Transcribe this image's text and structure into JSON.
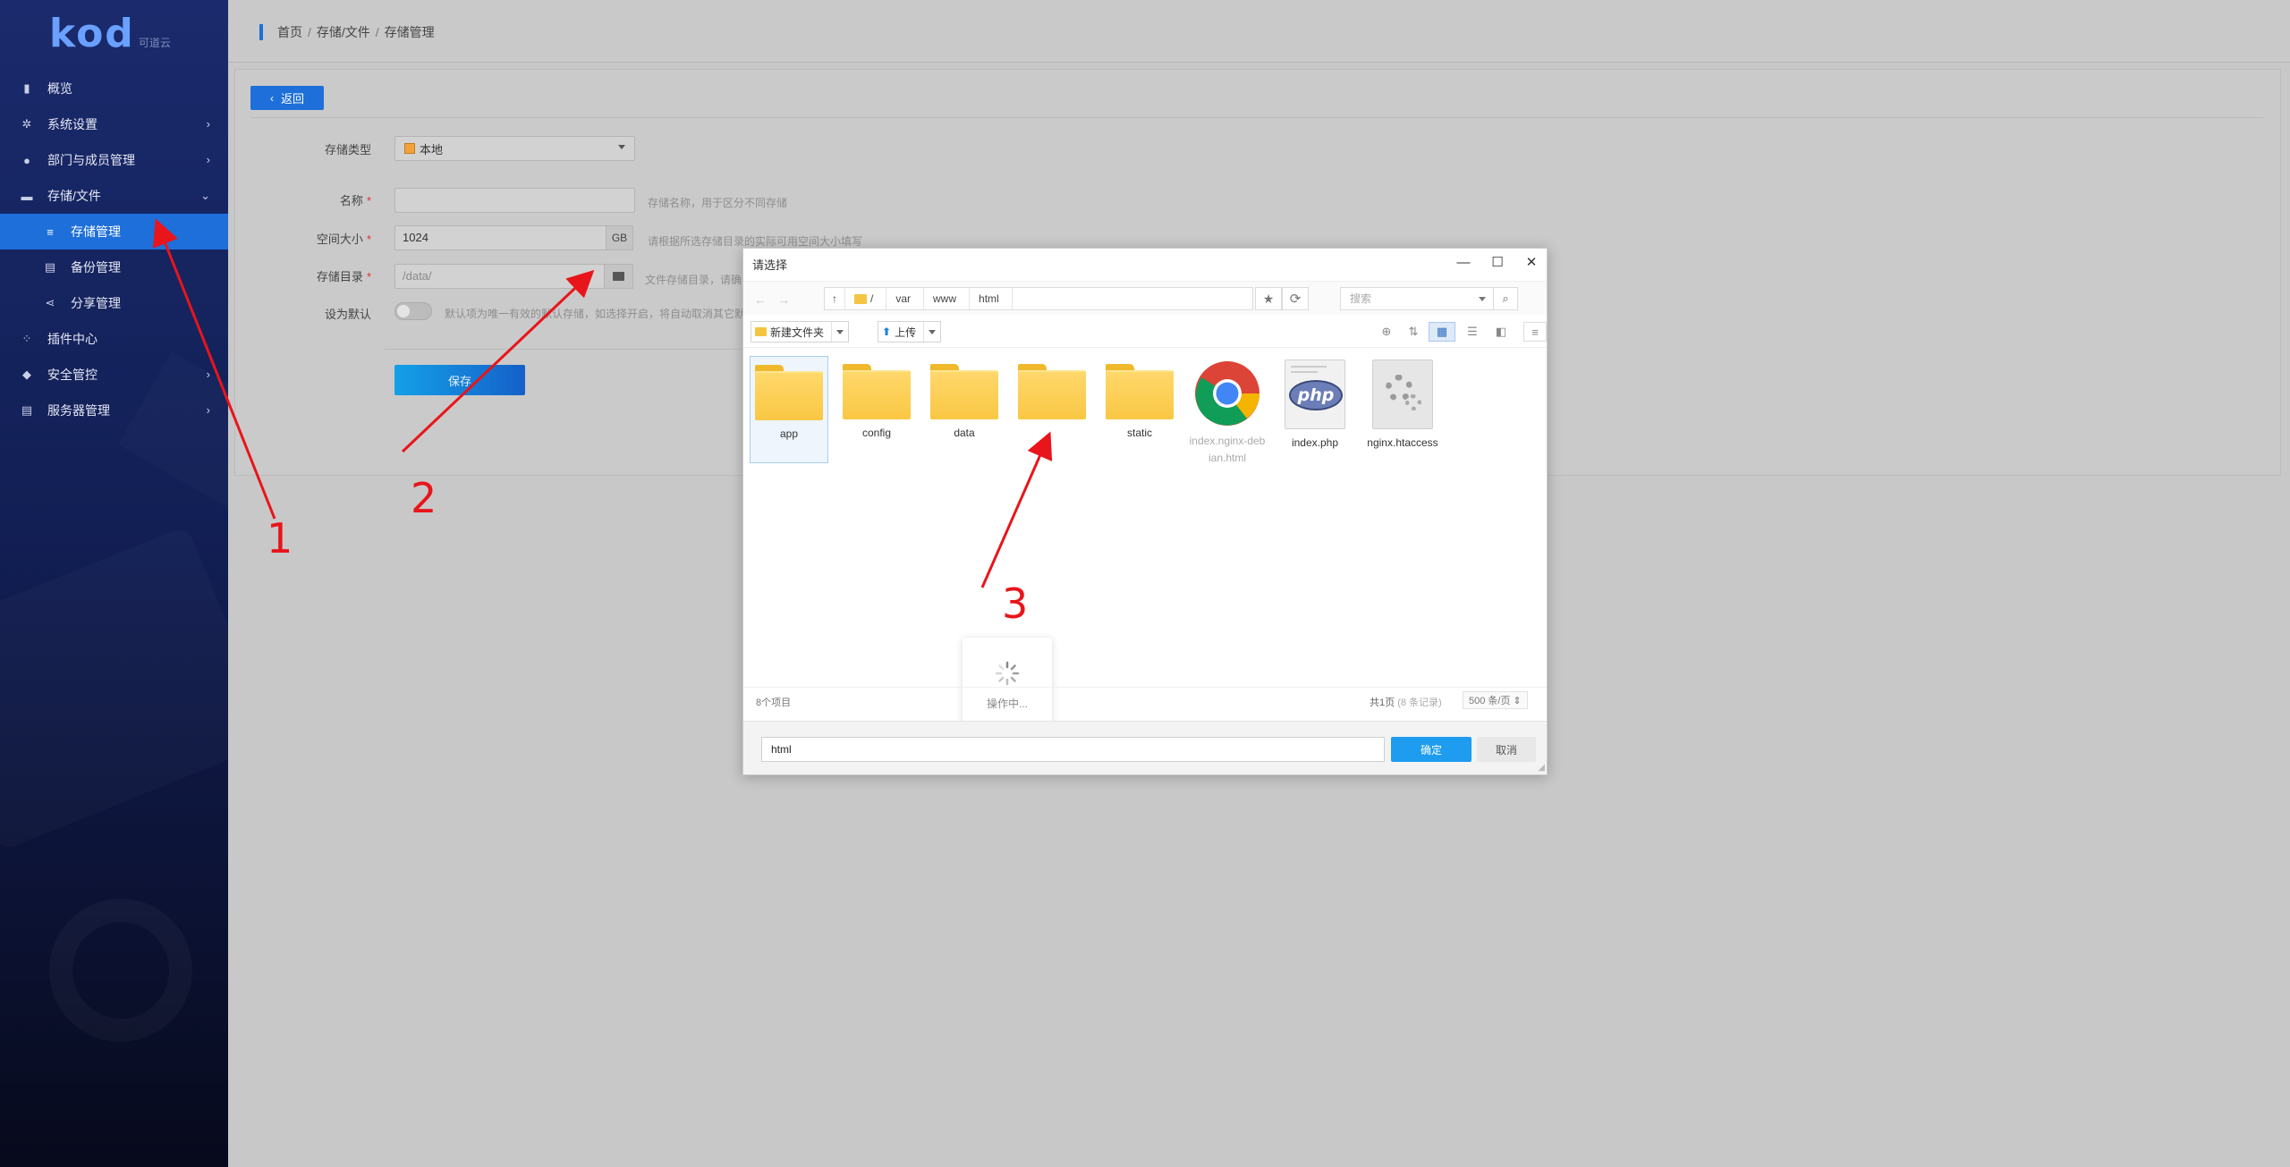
{
  "sidebar": {
    "logo_text": "kod",
    "logo_sub": "可道云",
    "items": [
      {
        "label": "概览",
        "icon": "bar-chart-icon",
        "glyph": "▮"
      },
      {
        "label": "系统设置",
        "icon": "gear-icon",
        "glyph": "✲"
      },
      {
        "label": "部门与成员管理",
        "icon": "user-icon",
        "glyph": "●"
      },
      {
        "label": "存储/文件",
        "icon": "folder-icon",
        "glyph": "▬"
      },
      {
        "label": "存储管理",
        "icon": "database-icon",
        "glyph": "≡"
      },
      {
        "label": "备份管理",
        "icon": "backup-icon",
        "glyph": "▤"
      },
      {
        "label": "分享管理",
        "icon": "share-icon",
        "glyph": "⋖"
      },
      {
        "label": "插件中心",
        "icon": "plugins-icon",
        "glyph": "⁘"
      },
      {
        "label": "安全管控",
        "icon": "shield-icon",
        "glyph": "◆"
      },
      {
        "label": "服务器管理",
        "icon": "server-icon",
        "glyph": "▤"
      }
    ]
  },
  "breadcrumb": {
    "home": "首页",
    "level2": "存储/文件",
    "current": "存储管理",
    "sep": "/"
  },
  "form": {
    "back_label": "返回",
    "type_label": "存储类型",
    "type_value": "本地",
    "name_label": "名称",
    "name_hint": "存储名称，用于区分不同存储",
    "size_label": "空间大小",
    "size_value": "1024",
    "size_unit": "GB",
    "size_hint": "请根据所选存储目录的实际可用空间大小填写",
    "dir_label": "存储目录",
    "dir_placeholder": "/data/",
    "dir_hint": "文件存储目录，请确",
    "default_label": "设为默认",
    "default_hint": "默认项为唯一有效的默认存储，如选择开启，将自动取消其它默认",
    "required_mark": "*",
    "save_label": "保存"
  },
  "dialog": {
    "title": "请选择",
    "path": [
      "/",
      "var",
      "www",
      "html"
    ],
    "search_placeholder": "搜索",
    "new_folder_label": "新建文件夹",
    "upload_label": "上传",
    "files": [
      {
        "name": "app",
        "kind": "folder"
      },
      {
        "name": "config",
        "kind": "folder"
      },
      {
        "name": "data",
        "kind": "folder"
      },
      {
        "name": "",
        "kind": "folder"
      },
      {
        "name": "static",
        "kind": "folder"
      },
      {
        "name": "index.nginx-debian.html",
        "kind": "chrome"
      },
      {
        "name": "index.php",
        "kind": "php"
      },
      {
        "name": "nginx.htaccess",
        "kind": "config"
      }
    ],
    "loading_text": "操作中...",
    "status_count": "8个项目",
    "status_pages": "共1页",
    "status_records": "(8 条记录)",
    "per_page": "500 条/页",
    "filename_value": "html",
    "ok_label": "确定",
    "cancel_label": "取消"
  },
  "annotations": {
    "n1": "1",
    "n2": "2",
    "n3": "3",
    "color": "#e8151a"
  }
}
